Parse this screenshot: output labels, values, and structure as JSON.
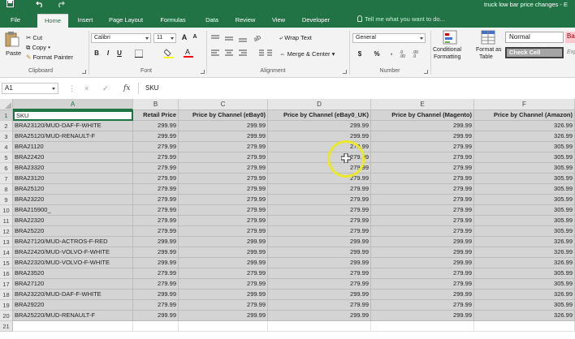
{
  "titlebar": {
    "file_title": "truck low bar price changes - E",
    "save_icon": "save-icon",
    "undo_icon": "undo-icon",
    "redo_icon": "redo-icon"
  },
  "tabs": [
    {
      "label": "File"
    },
    {
      "label": "Home"
    },
    {
      "label": "Insert"
    },
    {
      "label": "Page Layout"
    },
    {
      "label": "Formulas"
    },
    {
      "label": "Data"
    },
    {
      "label": "Review"
    },
    {
      "label": "View"
    },
    {
      "label": "Developer"
    }
  ],
  "tell_me": "Tell me what you want to do...",
  "ribbon": {
    "clipboard": {
      "paste": "Paste",
      "cut": "Cut",
      "copy": "Copy",
      "format_painter": "Format Painter",
      "label": "Clipboard"
    },
    "font": {
      "name": "Calibri",
      "size": "11",
      "bold": "B",
      "italic": "I",
      "underline": "U",
      "grow": "A",
      "shrink": "A",
      "label": "Font"
    },
    "alignment": {
      "wrap_text": "Wrap Text",
      "merge_center": "Merge & Center",
      "label": "Alignment"
    },
    "number": {
      "format": "General",
      "currency": "$",
      "percent": "%",
      "comma": ",",
      "label": "Number"
    },
    "styles": {
      "conditional": [
        "Conditional",
        "Formatting"
      ],
      "format_table": [
        "Format as",
        "Table"
      ],
      "normal": "Normal",
      "check_cell": "Check Cell",
      "bad": "Bad",
      "explanatory": "Explanatory"
    }
  },
  "formula_bar": {
    "name_box": "A1",
    "cancel": "×",
    "enter": "✓",
    "fx": "fx",
    "content": "SKU"
  },
  "columns": [
    "A",
    "B",
    "C",
    "D",
    "E",
    "F"
  ],
  "rows": [
    {
      "num": "1",
      "cells": [
        "SKU",
        "Retail Price",
        "Price by Channel (eBay0)",
        "Price by Channel (eBay0_UK)",
        "Price by Channel (Magento)",
        "Price by Channel (Amazon)"
      ]
    },
    {
      "num": "2",
      "cells": [
        "BRA23120/MUD-DAF-F-WHITE",
        "299.99",
        "299.99",
        "299.99",
        "299.99",
        "326.99"
      ]
    },
    {
      "num": "3",
      "cells": [
        "BRA25120/MUD-RENAULT-F",
        "299.99",
        "299.99",
        "299.99",
        "299.99",
        "326.99"
      ]
    },
    {
      "num": "4",
      "cells": [
        "BRA21120",
        "279.99",
        "279.99",
        "279.99",
        "279.99",
        "305.99"
      ]
    },
    {
      "num": "5",
      "cells": [
        "BRA22420",
        "279.99",
        "279.99",
        "279.99",
        "279.99",
        "305.99"
      ]
    },
    {
      "num": "6",
      "cells": [
        "BRA23320",
        "279.99",
        "279.99",
        "279.99",
        "279.99",
        "305.99"
      ]
    },
    {
      "num": "7",
      "cells": [
        "BRA23120",
        "279.99",
        "279.99",
        "279.99",
        "279.99",
        "305.99"
      ]
    },
    {
      "num": "8",
      "cells": [
        "BRA25120",
        "279.99",
        "279.99",
        "279.99",
        "279.99",
        "305.99"
      ]
    },
    {
      "num": "9",
      "cells": [
        "BRA23220",
        "279.99",
        "279.99",
        "279.99",
        "279.99",
        "305.99"
      ]
    },
    {
      "num": "10",
      "cells": [
        "BRA215900_",
        "279.99",
        "279.99",
        "279.99",
        "279.99",
        "305.99"
      ]
    },
    {
      "num": "11",
      "cells": [
        "BRA22320",
        "279.99",
        "279.99",
        "279.99",
        "279.99",
        "305.99"
      ]
    },
    {
      "num": "12",
      "cells": [
        "BRA25220",
        "279.99",
        "279.99",
        "279.99",
        "279.99",
        "305.99"
      ]
    },
    {
      "num": "13",
      "cells": [
        "BRA27120/MUD-ACTROS-F-RED",
        "299.99",
        "299.99",
        "299.99",
        "299.99",
        "326.99"
      ]
    },
    {
      "num": "14",
      "cells": [
        "BRA22420/MUD-VOLVO-F-WHITE",
        "299.99",
        "299.99",
        "299.99",
        "299.99",
        "326.99"
      ]
    },
    {
      "num": "15",
      "cells": [
        "BRA22320/MUD-VOLVO-F-WHITE",
        "299.99",
        "299.99",
        "299.99",
        "299.99",
        "326.99"
      ]
    },
    {
      "num": "16",
      "cells": [
        "BRA23520",
        "279.99",
        "279.99",
        "279.99",
        "279.99",
        "305.99"
      ]
    },
    {
      "num": "17",
      "cells": [
        "BRA27120",
        "279.99",
        "279.99",
        "279.99",
        "279.99",
        "305.99"
      ]
    },
    {
      "num": "18",
      "cells": [
        "BRA23220/MUD-DAF-F-WHITE",
        "299.99",
        "299.99",
        "299.99",
        "299.99",
        "326.99"
      ]
    },
    {
      "num": "19",
      "cells": [
        "BRA29220",
        "279.99",
        "279.99",
        "279.99",
        "279.99",
        "305.99"
      ]
    },
    {
      "num": "20",
      "cells": [
        "BRA25220/MUD-RENAULT-F",
        "299.99",
        "299.99",
        "299.99",
        "299.99",
        "326.99"
      ]
    },
    {
      "num": "21",
      "cells": [
        "",
        "",
        "",
        "",
        "",
        ""
      ]
    }
  ],
  "colors": {
    "accent": "#217346",
    "selection": "#d4d4d4",
    "cursor_highlight": "#e9e82c"
  }
}
